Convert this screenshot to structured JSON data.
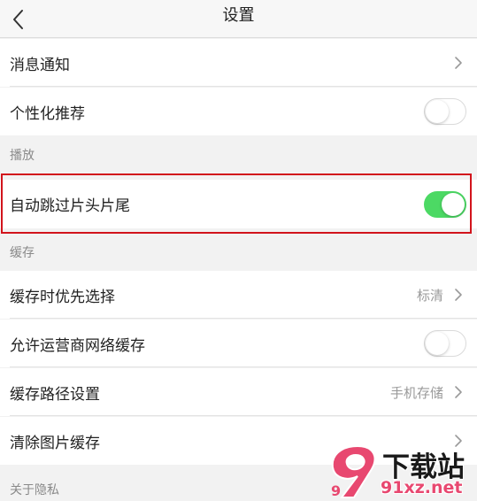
{
  "header": {
    "title": "设置",
    "back_icon": "chevron-left-icon"
  },
  "rows": {
    "notifications": {
      "label": "消息通知",
      "icon": "chevron-right-icon"
    },
    "personalized": {
      "label": "个性化推荐",
      "toggle_on": false
    },
    "skip_intro": {
      "label": "自动跳过片头片尾",
      "toggle_on": true
    },
    "cache_priority": {
      "label": "缓存时优先选择",
      "value": "标清",
      "icon": "chevron-right-icon"
    },
    "carrier_cache": {
      "label": "允许运营商网络缓存",
      "toggle_on": false
    },
    "cache_path": {
      "label": "缓存路径设置",
      "value": "手机存储",
      "icon": "chevron-right-icon"
    },
    "clear_image_cache": {
      "label": "清除图片缓存",
      "icon": "chevron-right-icon"
    }
  },
  "sections": {
    "playback": "播放",
    "cache": "缓存",
    "privacy": "关于隐私"
  },
  "watermark": {
    "logo_text": "9",
    "site_name": "下载站",
    "domain": "91xz.net"
  },
  "colors": {
    "background": "#f2f2f2",
    "toggle_on": "#4cd964",
    "highlight_frame": "#d2141c",
    "watermark_pink": "#e84870"
  }
}
